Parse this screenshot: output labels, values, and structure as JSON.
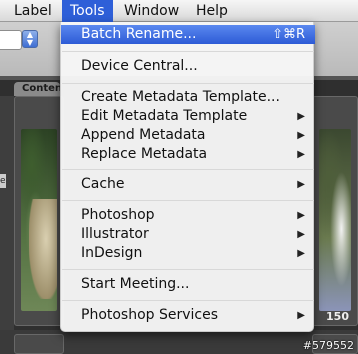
{
  "menubar": {
    "items": [
      {
        "label": "Label"
      },
      {
        "label": "Tools"
      },
      {
        "label": "Window"
      },
      {
        "label": "Help"
      }
    ]
  },
  "content_panel": {
    "tab_label": "Content",
    "side_letter": "e",
    "thumb_label": "150"
  },
  "tools_menu": {
    "items": [
      {
        "label": "Batch Rename...",
        "shortcut": "⇧⌘R"
      },
      {
        "label": "Device Central..."
      },
      {
        "label": "Create Metadata Template..."
      },
      {
        "label": "Edit Metadata Template",
        "arrow": "▶"
      },
      {
        "label": "Append Metadata",
        "arrow": "▶"
      },
      {
        "label": "Replace Metadata",
        "arrow": "▶"
      },
      {
        "label": "Cache",
        "arrow": "▶"
      },
      {
        "label": "Photoshop",
        "arrow": "▶"
      },
      {
        "label": "Illustrator",
        "arrow": "▶"
      },
      {
        "label": "InDesign",
        "arrow": "▶"
      },
      {
        "label": "Start Meeting..."
      },
      {
        "label": "Photoshop Services",
        "arrow": "▶"
      }
    ]
  },
  "watermark": "#579552",
  "colors": {
    "menu_highlight": "#3a68df",
    "menubar_active": "#2e5fd8"
  }
}
